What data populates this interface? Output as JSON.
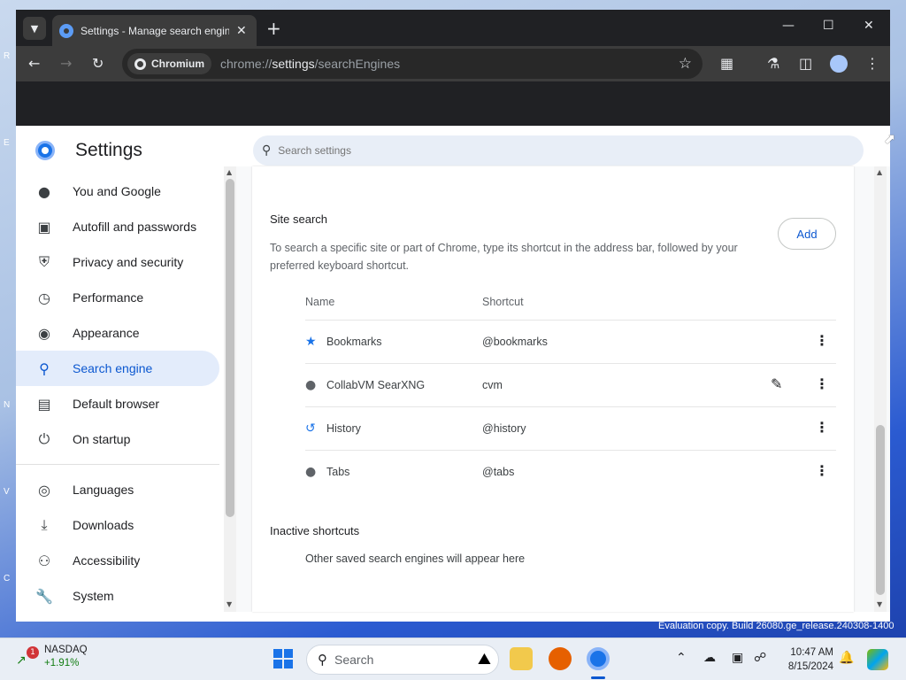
{
  "desktop": {
    "edge_letters": [
      "R",
      "E",
      "N",
      "V",
      "C"
    ],
    "watermark": "Evaluation copy. Build 26080.ge_release.240308-1400"
  },
  "browser": {
    "tab_title": "Settings - Manage search engines",
    "brand_chip": "Chromium",
    "url_prefix": "chrome://",
    "url_host": "settings",
    "url_path": "/searchEngines"
  },
  "settings": {
    "title": "Settings",
    "search_placeholder": "Search settings",
    "nav": [
      {
        "label": "You and Google",
        "icon": "person-icon"
      },
      {
        "label": "Autofill and passwords",
        "icon": "clipboard-icon"
      },
      {
        "label": "Privacy and security",
        "icon": "shield-icon"
      },
      {
        "label": "Performance",
        "icon": "speedometer-icon"
      },
      {
        "label": "Appearance",
        "icon": "palette-icon"
      },
      {
        "label": "Search engine",
        "icon": "search-icon",
        "active": true
      },
      {
        "label": "Default browser",
        "icon": "browser-icon"
      },
      {
        "label": "On startup",
        "icon": "power-icon"
      },
      {
        "label": "Languages",
        "icon": "globe-icon"
      },
      {
        "label": "Downloads",
        "icon": "download-icon"
      },
      {
        "label": "Accessibility",
        "icon": "accessibility-icon"
      },
      {
        "label": "System",
        "icon": "wrench-icon"
      }
    ],
    "site_search": {
      "title": "Site search",
      "description": "To search a specific site or part of Chrome, type its shortcut in the address bar, followed by your preferred keyboard shortcut.",
      "add_label": "Add",
      "col_name": "Name",
      "col_shortcut": "Shortcut",
      "rows": [
        {
          "name": "Bookmarks",
          "shortcut": "@bookmarks",
          "icon": "star-icon"
        },
        {
          "name": "CollabVM SearXNG",
          "shortcut": "cvm",
          "icon": "globe-icon",
          "editable": true
        },
        {
          "name": "History",
          "shortcut": "@history",
          "icon": "history-icon"
        },
        {
          "name": "Tabs",
          "shortcut": "@tabs",
          "icon": "globe-icon"
        }
      ]
    },
    "inactive": {
      "title": "Inactive shortcuts",
      "description": "Other saved search engines will appear here"
    }
  },
  "taskbar": {
    "widget_badge": "1",
    "widget_name": "NASDAQ",
    "widget_change": "+1.91%",
    "search_label": "Search",
    "time": "10:47 AM",
    "date": "8/15/2024"
  }
}
